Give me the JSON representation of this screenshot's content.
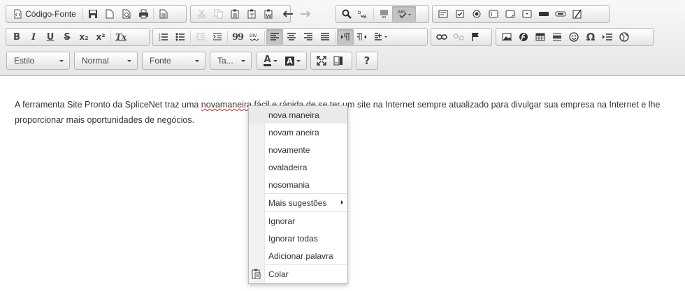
{
  "toolbar": {
    "source_label": "Código-Fonte",
    "styles_combo": "Estilo",
    "format_combo": "Normal",
    "font_combo": "Fonte",
    "size_combo": "Ta...",
    "help_label": "?",
    "bold_label": "B",
    "italic_label": "I",
    "underline_label": "U",
    "strike_label": "S",
    "subscript_label": "x₂",
    "superscript_label": "x²",
    "removeformat_label": "Tx",
    "blockquote_label": "99",
    "omega_label": "Ω",
    "font_color_label": "A",
    "bg_color_label": "A",
    "spell_label": "ABC"
  },
  "editor": {
    "text_before": "A ferramenta Site Pronto da SpliceNet traz uma ",
    "misspelled_word": "novamaneira",
    "text_after": " fácil e rápida de se ter um site na Internet sempre atualizado para divulgar sua empresa na Internet e lhe proporcionar mais oportunidades de negócios."
  },
  "context_menu": {
    "suggestions": [
      "nova maneira",
      "novam aneira",
      "novamente",
      "ovaladeira",
      "nosomania"
    ],
    "more_suggestions": "Mais sugestões",
    "ignore": "Ignorar",
    "ignore_all": "Ignorar todas",
    "add_word": "Adicionar palavra",
    "paste": "Colar"
  }
}
